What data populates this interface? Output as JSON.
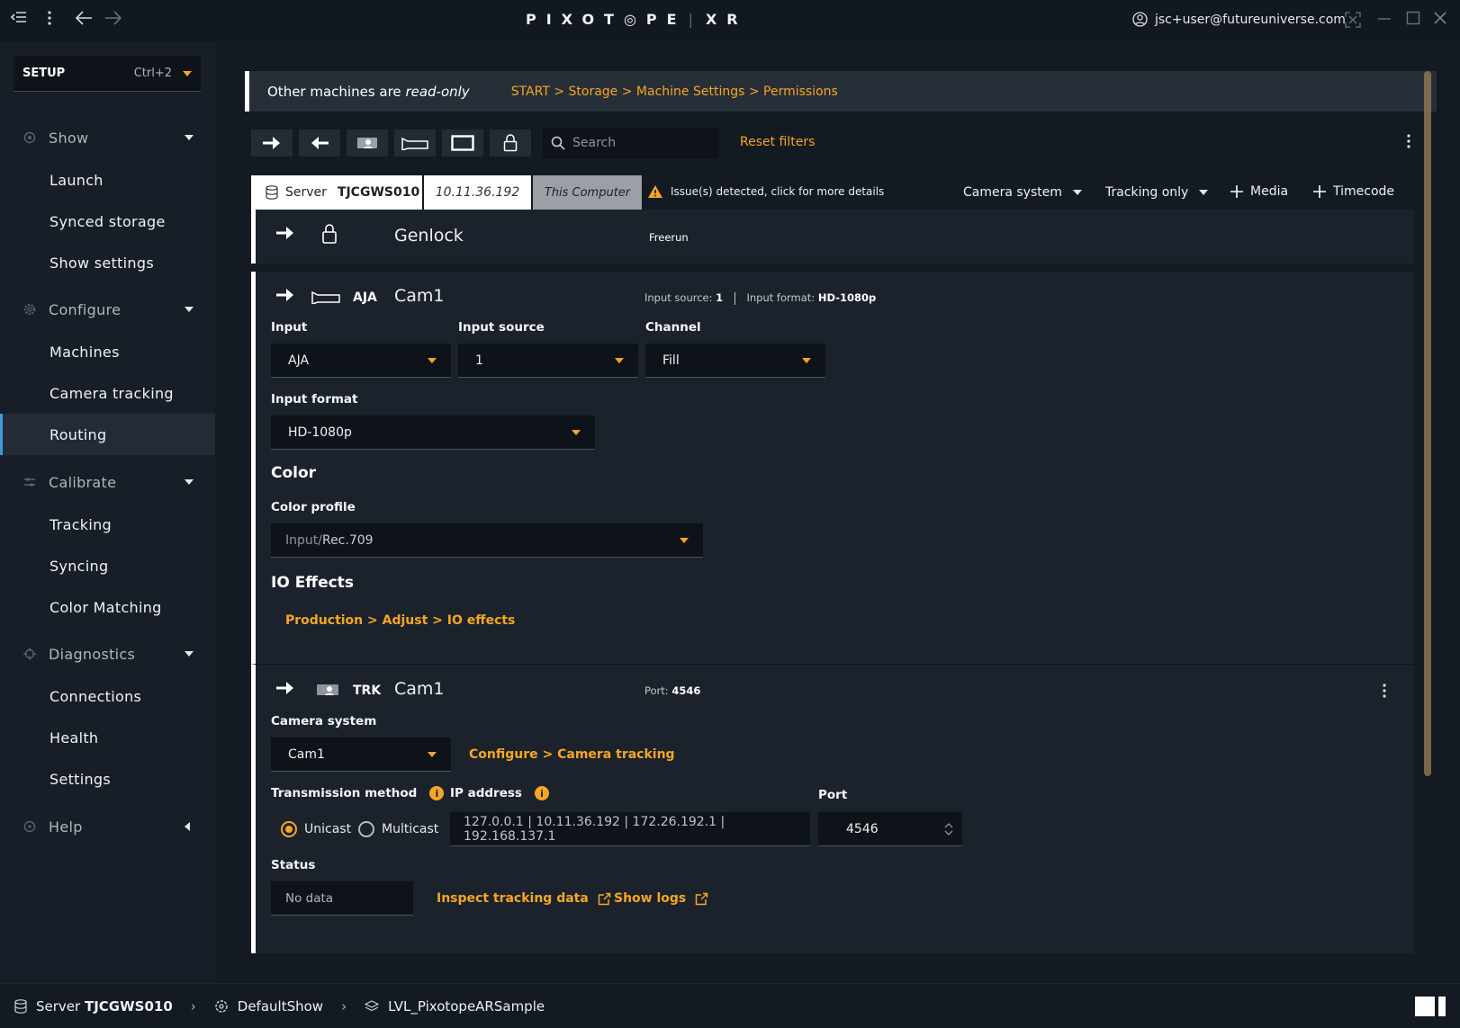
{
  "titlebar": {
    "logo_main": "PIXOT◎PE",
    "logo_sep": "|",
    "logo_suffix": "XR",
    "user_email": "jsc+user@futureuniverse.com"
  },
  "sidebar": {
    "mode": {
      "label": "SETUP",
      "shortcut": "Ctrl+2"
    },
    "groups": [
      {
        "label": "Show",
        "items": [
          "Launch",
          "Synced storage",
          "Show settings"
        ]
      },
      {
        "label": "Configure",
        "items": [
          "Machines",
          "Camera tracking",
          "Routing"
        ]
      },
      {
        "label": "Calibrate",
        "items": [
          "Tracking",
          "Syncing",
          "Color Matching"
        ]
      },
      {
        "label": "Diagnostics",
        "items": [
          "Connections",
          "Health",
          "Settings"
        ]
      },
      {
        "label": "Help",
        "items": []
      }
    ],
    "active_item": "Routing"
  },
  "banner": {
    "text_prefix": "Other machines are ",
    "text_emph": "read-only",
    "breadcrumb": "START > Storage > Machine Settings > Permissions"
  },
  "toolbar": {
    "search_placeholder": "Search",
    "reset_label": "Reset filters"
  },
  "server": {
    "label": "Server",
    "name": "TJCGWS010",
    "ip": "10.11.36.192",
    "this_computer": "This Computer",
    "issue": "Issue(s) detected, click for more details",
    "camera_system_filter": "Camera system",
    "tracking_filter": "Tracking only",
    "add_media": "Media",
    "add_timecode": "Timecode"
  },
  "genlock": {
    "title": "Genlock",
    "mode": "Freerun"
  },
  "aja": {
    "tag": "AJA",
    "title": "Cam1",
    "meta_source_label": "Input source:",
    "meta_source_value": "1",
    "meta_format_label": "Input format:",
    "meta_format_value": "HD-1080p",
    "input_label": "Input",
    "input_value": "AJA",
    "input_source_label": "Input source",
    "input_source_value": "1",
    "channel_label": "Channel",
    "channel_value": "Fill",
    "input_format_label": "Input format",
    "input_format_value": "HD-1080p",
    "color_title": "Color",
    "color_profile_label": "Color profile",
    "color_profile_prefix": "Input/",
    "color_profile_value": "Rec.709",
    "io_title": "IO Effects",
    "io_link": "Production > Adjust > IO effects"
  },
  "trk": {
    "tag": "TRK",
    "title": "Cam1",
    "meta_port_label": "Port:",
    "meta_port_value": "4546",
    "camera_system_label": "Camera system",
    "camera_system_value": "Cam1",
    "configure_link": "Configure > Camera tracking",
    "transmission_label": "Transmission method",
    "unicast": "Unicast",
    "multicast": "Multicast",
    "ip_label": "IP address",
    "ip_value": "127.0.0.1 | 10.11.36.192 | 172.26.192.1 | 192.168.137.1",
    "port_label": "Port",
    "port_value": "4546",
    "status_label": "Status",
    "status_value": "No data",
    "inspect_link": "Inspect tracking data",
    "logs_link": "Show logs"
  },
  "statusbar": {
    "server_label": "Server",
    "server_name": "TJCGWS010",
    "show": "DefaultShow",
    "level": "LVL_PixotopeARSample"
  },
  "colors": {
    "accent": "#f5a623",
    "active_nav": "#3d9bd9",
    "bg": "#141a22",
    "panel": "#1b222b"
  }
}
